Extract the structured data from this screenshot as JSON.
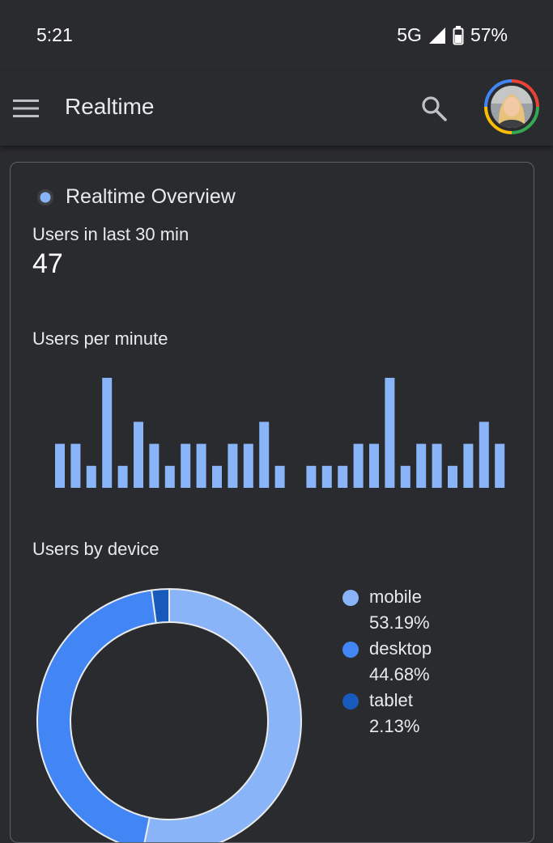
{
  "status_bar": {
    "time": "5:21",
    "network": "5G",
    "battery": "57%",
    "signal_icon": "signal-icon",
    "battery_icon": "battery-icon"
  },
  "app_bar": {
    "title": "Realtime",
    "menu_icon": "menu-icon",
    "search_icon": "search-icon",
    "avatar_icon": "account-avatar"
  },
  "card": {
    "title": "Realtime Overview",
    "users_label": "Users in last 30 min",
    "users_value": "47",
    "per_minute_label": "Users per minute",
    "device_label": "Users by device"
  },
  "colors": {
    "background": "#2a2b2f",
    "bar": "#8ab4f8",
    "mobile": "#8ab4f8",
    "desktop": "#4285f4",
    "tablet": "#185abc",
    "card_border": "#5f6368"
  },
  "chart_data": [
    {
      "type": "bar",
      "title": "Users per minute",
      "values": [
        2,
        2,
        1,
        5,
        1,
        3,
        2,
        1,
        2,
        2,
        1,
        2,
        2,
        3,
        1,
        0,
        1,
        1,
        1,
        2,
        2,
        5,
        1,
        2,
        2,
        1,
        2,
        3,
        2
      ],
      "ylim": [
        0,
        5
      ],
      "grid": false
    },
    {
      "type": "pie",
      "title": "Users by device",
      "categories": [
        "mobile",
        "desktop",
        "tablet"
      ],
      "values": [
        53.19,
        44.68,
        2.13
      ],
      "labels": [
        "53.19%",
        "44.68%",
        "2.13%"
      ],
      "colors": [
        "#8ab4f8",
        "#4285f4",
        "#185abc"
      ],
      "legend": "right"
    }
  ]
}
